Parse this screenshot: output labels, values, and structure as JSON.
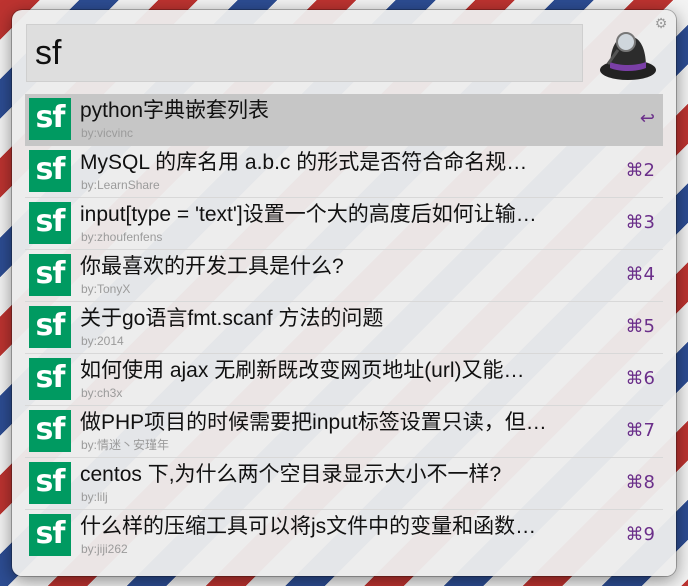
{
  "search": {
    "query": "sf"
  },
  "results": [
    {
      "title": "python字典嵌套列表",
      "author": "by:vicvinc",
      "shortcut": "↩"
    },
    {
      "title": "MySQL 的库名用 a.b.c 的形式是否符合命名规…",
      "author": "by:LearnShare",
      "shortcut": "⌘2"
    },
    {
      "title": "input[type = 'text']设置一个大的高度后如何让输…",
      "author": "by:zhoufenfens",
      "shortcut": "⌘3"
    },
    {
      "title": "你最喜欢的开发工具是什么?",
      "author": "by:TonyX",
      "shortcut": "⌘4"
    },
    {
      "title": "关于go语言fmt.scanf 方法的问题",
      "author": "by:2014",
      "shortcut": "⌘5"
    },
    {
      "title": "如何使用  ajax 无刷新既改变网页地址(url)又能…",
      "author": "by:ch3x",
      "shortcut": "⌘6"
    },
    {
      "title": "做PHP项目的时候需要把input标签设置只读，但…",
      "author": "by:情迷丶安瑾年",
      "shortcut": "⌘7"
    },
    {
      "title": "centos 下,为什么两个空目录显示大小不一样?",
      "author": "by:lilj",
      "shortcut": "⌘8"
    },
    {
      "title": "什么样的压缩工具可以将js文件中的变量和函数…",
      "author": "by:jiji262",
      "shortcut": "⌘9"
    }
  ],
  "logo_text": "sf",
  "colors": {
    "sf_green": "#009a61",
    "shortcut": "#6b2f8a",
    "selected_row": "#c6c6c6"
  }
}
